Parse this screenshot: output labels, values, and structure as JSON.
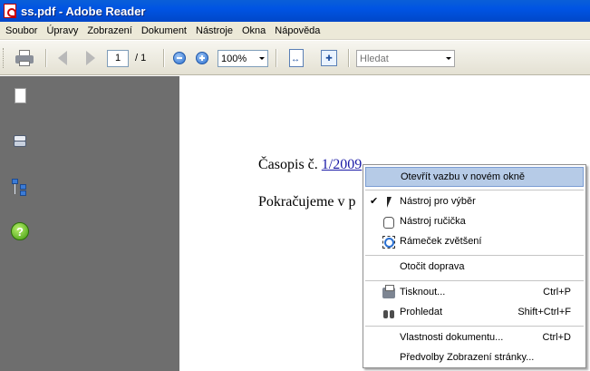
{
  "window": {
    "title": "ss.pdf - Adobe Reader"
  },
  "menubar": {
    "items": [
      "Soubor",
      "Úpravy",
      "Zobrazení",
      "Dokument",
      "Nástroje",
      "Okna",
      "Nápověda"
    ]
  },
  "toolbar": {
    "page_current": "1",
    "page_total": "/ 1",
    "zoom": "100%",
    "search_placeholder": "Hledat"
  },
  "navpanel": {
    "icons": [
      "pages-icon",
      "layers-icon",
      "bookmarks-icon",
      "help-icon"
    ],
    "help_glyph": "?"
  },
  "document": {
    "line1_prefix": "Časopis č. ",
    "line1_link": "1/2009",
    "line2": "Pokračujeme v p"
  },
  "context_menu": {
    "items": [
      {
        "label": "Otevřít vazbu v novém okně",
        "shortcut": "",
        "highlight": true
      },
      {
        "label": "Nástroj pro výběr",
        "shortcut": "",
        "checked": true,
        "icon": "select-cursor-icon"
      },
      {
        "label": "Nástroj ručička",
        "shortcut": "",
        "icon": "hand-icon"
      },
      {
        "label": "Rámeček zvětšení",
        "shortcut": "",
        "icon": "marquee-zoom-icon"
      },
      {
        "label": "Otočit doprava",
        "shortcut": ""
      },
      {
        "label": "Tisknout...",
        "shortcut": "Ctrl+P",
        "icon": "print-icon"
      },
      {
        "label": "Prohledat",
        "shortcut": "Shift+Ctrl+F",
        "icon": "binoculars-icon"
      },
      {
        "label": "Vlastnosti dokumentu...",
        "shortcut": "Ctrl+D"
      },
      {
        "label": "Předvolby Zobrazení stránky...",
        "shortcut": ""
      }
    ],
    "check_glyph": "✔"
  },
  "colors": {
    "titlebar": "#0054e3",
    "navpanel": "#6e6e6e",
    "menu_highlight": "#b6cbe7",
    "link": "#1a1aa6"
  }
}
